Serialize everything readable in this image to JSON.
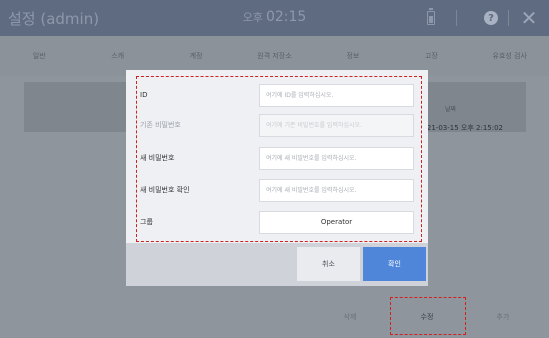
{
  "app": {
    "title": "설정 (admin)",
    "clock_ampm": "오후",
    "clock_time": "02:15",
    "icons": {
      "battery": "battery-icon",
      "help": "help-icon",
      "close": "close-icon"
    },
    "close_glyph": "✕",
    "help_glyph": "?"
  },
  "tabs": [
    "일반",
    "스캐",
    "계정",
    "원격 저장소",
    "정보",
    "고장",
    "유효성 검사"
  ],
  "background_table": {
    "header": "날짜",
    "cell": "2021-03-15 오후 2:15:02"
  },
  "background_buttons": {
    "delete": "삭제",
    "edit": "수정",
    "add": "추가"
  },
  "modal": {
    "fields": [
      {
        "label": "ID",
        "placeholder": "여기에 ID를 입력하십시오.",
        "disabled": false
      },
      {
        "label": "기존 비밀번호",
        "placeholder": "여기에 기존 비밀번호를 입력하십시오.",
        "disabled": true
      },
      {
        "label": "새 비밀번호",
        "placeholder": "여기에 새 비밀번호를 입력하십시오.",
        "disabled": false
      },
      {
        "label": "새 비밀번호 확인",
        "placeholder": "여기에 새 비밀번호를 입력하십시오.",
        "disabled": false
      }
    ],
    "group": {
      "label": "그룹",
      "value": "Operator"
    },
    "cancel_label": "취소",
    "ok_label": "확인"
  },
  "colors": {
    "topbar": "#5f6b80",
    "ok_button": "#4f86d9",
    "highlight": "#d02020"
  }
}
